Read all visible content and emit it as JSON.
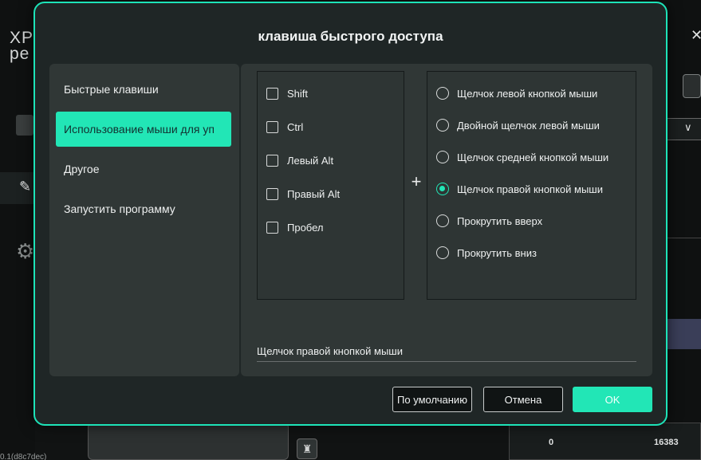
{
  "background": {
    "logo_text": "XP\npe",
    "version": "0.1(d8c7dec)",
    "range_min": "0",
    "range_max": "16383"
  },
  "dialog": {
    "title": "клавиша быстрого доступа",
    "nav": [
      {
        "label": "Быстрые клавиши",
        "active": false
      },
      {
        "label": "Использование мыши для уп",
        "active": true
      },
      {
        "label": "Другое",
        "active": false
      },
      {
        "label": "Запустить программу",
        "active": false
      }
    ],
    "modifiers": [
      {
        "label": "Shift",
        "checked": false
      },
      {
        "label": "Ctrl",
        "checked": false
      },
      {
        "label": "Левый Alt",
        "checked": false
      },
      {
        "label": "Правый Alt",
        "checked": false
      },
      {
        "label": "Пробел",
        "checked": false
      }
    ],
    "plus": "+",
    "mouse_actions": [
      {
        "label": "Щелчок левой кнопкой мыши",
        "selected": false
      },
      {
        "label": "Двойной щелчок левой мыши",
        "selected": false
      },
      {
        "label": "Щелчок средней кнопкой мыши",
        "selected": false
      },
      {
        "label": "Щелчок правой кнопкой мыши",
        "selected": true
      },
      {
        "label": "Прокрутить вверх",
        "selected": false
      },
      {
        "label": "Прокрутить вниз",
        "selected": false
      }
    ],
    "summary": "Щелчок правой кнопкой мыши",
    "buttons": {
      "default": "По умолчанию",
      "cancel": "Отмена",
      "ok": "OK"
    }
  },
  "colors": {
    "accent": "#22e6b6",
    "dialog_bg": "#1f2626",
    "panel_bg": "#303736"
  }
}
